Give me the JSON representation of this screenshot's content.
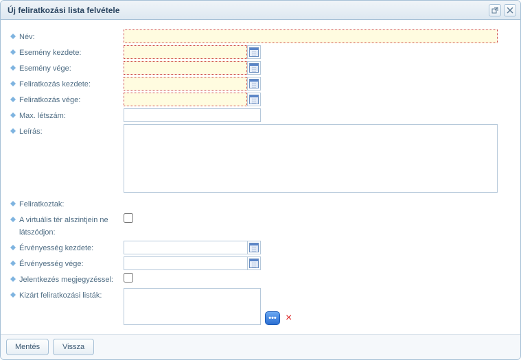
{
  "dialog": {
    "title": "Új feliratkozási lista felvétele"
  },
  "labels": {
    "name": "Név:",
    "event_start": "Esemény kezdete:",
    "event_end": "Esemény vége:",
    "signup_start": "Feliratkozás kezdete:",
    "signup_end": "Feliratkozás vége:",
    "max_count": "Max. létszám:",
    "description": "Leírás:",
    "subscribed": "Feliratkoztak:",
    "hide_sublevels": "A virtuális tér alszintjein ne látszódjon:",
    "validity_start": "Érvényesség kezdete:",
    "validity_end": "Érvényesség vége:",
    "apply_with_comment": "Jelentkezés megjegyzéssel:",
    "excluded_lists": "Kizárt feliratkozási listák:"
  },
  "values": {
    "name": "",
    "event_start": "",
    "event_end": "",
    "signup_start": "",
    "signup_end": "",
    "max_count": "",
    "description": "",
    "validity_start": "",
    "validity_end": ""
  },
  "buttons": {
    "save": "Mentés",
    "back": "Vissza"
  },
  "icons": {
    "select_dots": "•••",
    "remove": "×"
  }
}
